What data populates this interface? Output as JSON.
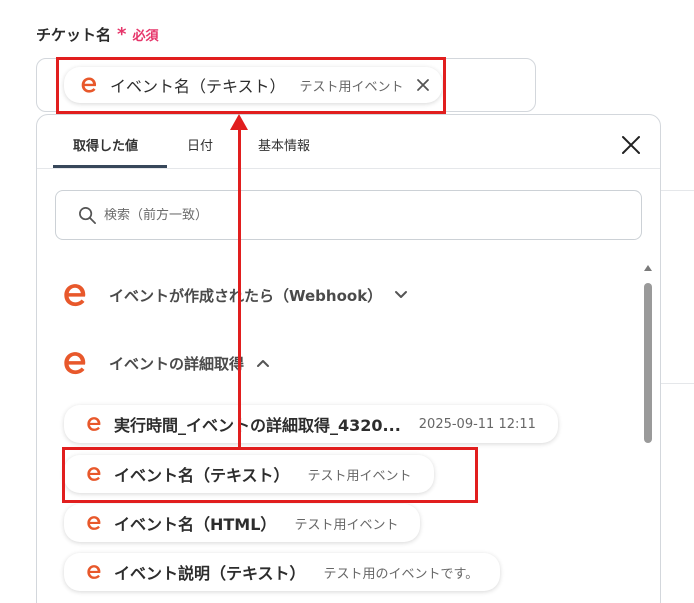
{
  "field": {
    "label": "チケット名",
    "required_star": "*",
    "required_text": "必須"
  },
  "selected_token": {
    "label": "イベント名（テキスト）",
    "value": "テスト用イベント"
  },
  "panel": {
    "tabs": [
      {
        "label": "取得した値",
        "active": true
      },
      {
        "label": "日付",
        "active": false
      },
      {
        "label": "基本情報",
        "active": false
      }
    ],
    "search": {
      "placeholder": "検索（前方一致）"
    },
    "sections": [
      {
        "title": "イベントが作成されたら（Webhook）",
        "expanded": false
      },
      {
        "title": "イベントの詳細取得",
        "expanded": true
      }
    ],
    "items": [
      {
        "label": "実行時間_イベントの詳細取得_4320...",
        "value": "2025-09-11 12:11"
      },
      {
        "label": "イベント名（テキスト）",
        "value": "テスト用イベント"
      },
      {
        "label": "イベント名（HTML）",
        "value": "テスト用イベント"
      },
      {
        "label": "イベント説明（テキスト）",
        "value": "テスト用のイベントです。"
      }
    ]
  },
  "colors": {
    "brand_icon": "#e8582b",
    "required": "#e6356a",
    "highlight": "#e11e1e",
    "tab_underline": "#37475a"
  },
  "icons": [
    "e-brand-icon",
    "close-icon",
    "search-icon",
    "chevron-down-icon",
    "chevron-up-icon"
  ]
}
